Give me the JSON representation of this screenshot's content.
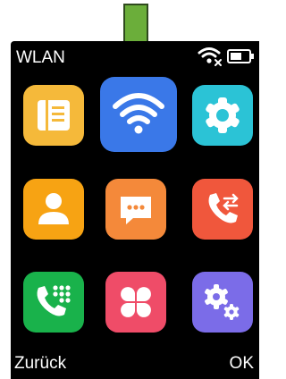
{
  "statusbar": {
    "title": "WLAN",
    "icons": [
      "wifi-no-internet-icon",
      "battery-icon"
    ]
  },
  "menu": {
    "selected": "wlan",
    "items": [
      {
        "id": "notes",
        "icon": "list-icon",
        "color": "#F5B93A"
      },
      {
        "id": "wlan",
        "icon": "wifi-icon",
        "color": "#3A78E8"
      },
      {
        "id": "settings",
        "icon": "gear-icon",
        "color": "#2BC3D6"
      },
      {
        "id": "contacts",
        "icon": "person-icon",
        "color": "#F7A313"
      },
      {
        "id": "messages",
        "icon": "chat-bubble-icon",
        "color": "#F4893A"
      },
      {
        "id": "call-forward",
        "icon": "phone-transfer-icon",
        "color": "#F0573C"
      },
      {
        "id": "speed-dial",
        "icon": "phone-keypad-icon",
        "color": "#19B24B"
      },
      {
        "id": "apps",
        "icon": "clover-icon",
        "color": "#EF4C68"
      },
      {
        "id": "advanced-settings",
        "icon": "gears-icon",
        "color": "#7B6CE8"
      }
    ]
  },
  "softkeys": {
    "left": "Zurück",
    "right": "OK"
  },
  "colors": {
    "screen_bg": "#000000",
    "arrow": "#6BAE3A",
    "arrow_outline": "#2F4A1E"
  }
}
